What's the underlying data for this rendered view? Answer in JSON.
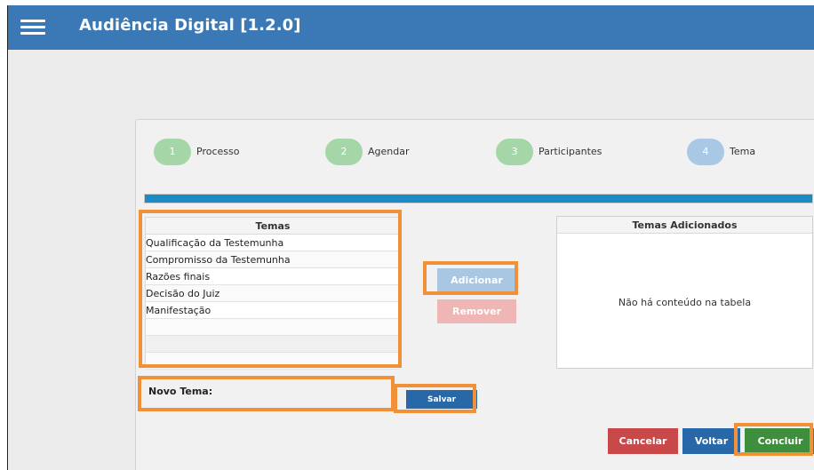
{
  "header": {
    "title": "Audiência Digital [1.2.0]"
  },
  "steps": [
    {
      "number": "1",
      "label": "Processo"
    },
    {
      "number": "2",
      "label": "Agendar"
    },
    {
      "number": "3",
      "label": "Participantes"
    },
    {
      "number": "4",
      "label": "Tema"
    }
  ],
  "progress": {
    "value": 1.0
  },
  "temas": {
    "header": "Temas",
    "rows": [
      "Qualificação da Testemunha",
      "Compromisso da Testemunha",
      "Razões finais",
      "Decisão do Juiz",
      "Manifestação",
      "",
      "",
      ""
    ]
  },
  "temas_adicionados": {
    "header": "Temas Adicionados",
    "empty_message": "Não há conteúdo na tabela"
  },
  "buttons": {
    "adicionar": "Adicionar",
    "remover": "Remover",
    "salvar": "Salvar",
    "cancelar": "Cancelar",
    "voltar": "Voltar",
    "concluir": "Concluir"
  },
  "novo_tema": {
    "label": "Novo Tema:",
    "value": ""
  },
  "colors": {
    "header_bar": "#3b78b6",
    "highlight": "#f0913a",
    "step_done": "#a5d6a7",
    "step_current": "#a8c8e6",
    "progress": "#1b8bc6"
  }
}
